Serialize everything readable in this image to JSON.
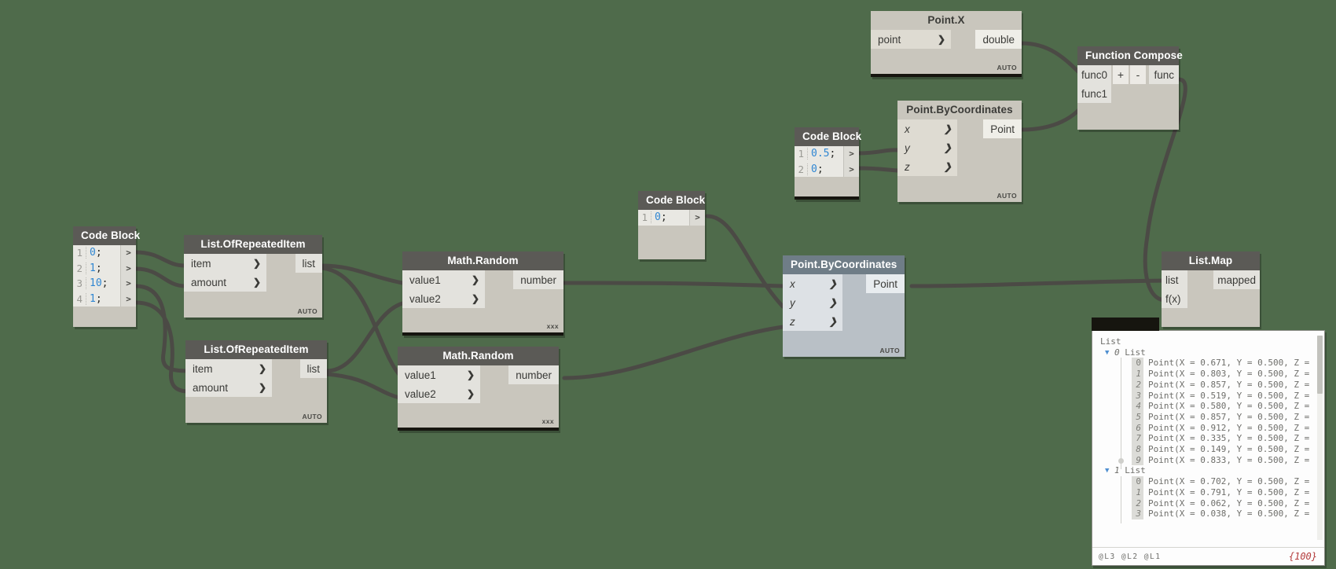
{
  "canvas": {
    "background": "#4f6b4b"
  },
  "nodes": {
    "code_block_1": {
      "title": "Code Block",
      "lines": [
        {
          "n": "1",
          "code": "0",
          "term": ";"
        },
        {
          "n": "2",
          "code": "1",
          "term": ";"
        },
        {
          "n": "3",
          "code": "10",
          "term": ";"
        },
        {
          "n": "4",
          "code": "1",
          "term": ";"
        }
      ],
      "out_marker": ">"
    },
    "list_of_repeated_item_1": {
      "title": "List.OfRepeatedItem",
      "inputs": [
        "item",
        "amount"
      ],
      "output": "list",
      "footer": "AUTO"
    },
    "list_of_repeated_item_2": {
      "title": "List.OfRepeatedItem",
      "inputs": [
        "item",
        "amount"
      ],
      "output": "list",
      "footer": "AUTO"
    },
    "math_random_1": {
      "title": "Math.Random",
      "inputs": [
        "value1",
        "value2"
      ],
      "output": "number",
      "footer": "xxx"
    },
    "math_random_2": {
      "title": "Math.Random",
      "inputs": [
        "value1",
        "value2"
      ],
      "output": "number",
      "footer": "xxx"
    },
    "code_block_2": {
      "title": "Code Block",
      "lines": [
        {
          "n": "1",
          "code": "0",
          "term": ";"
        }
      ],
      "out_marker": ">"
    },
    "code_block_3": {
      "title": "Code Block",
      "lines": [
        {
          "n": "1",
          "code": "0.5",
          "term": ";"
        },
        {
          "n": "2",
          "code": "0",
          "term": ";"
        }
      ],
      "out_marker": ">"
    },
    "point_bycoordinates_main": {
      "title": "Point.ByCoordinates",
      "inputs": [
        "x",
        "y",
        "z"
      ],
      "output": "Point",
      "footer": "AUTO"
    },
    "point_bycoordinates_top": {
      "title": "Point.ByCoordinates",
      "inputs": [
        "x",
        "y",
        "z"
      ],
      "output": "Point",
      "footer": "AUTO"
    },
    "point_x": {
      "title": "Point.X",
      "inputs": [
        "point"
      ],
      "output": "double",
      "footer": "AUTO"
    },
    "function_compose": {
      "title": "Function Compose",
      "inputs": [
        "func0",
        "func1"
      ],
      "output": "func",
      "buttons": [
        "+",
        "-"
      ]
    },
    "list_map": {
      "title": "List.Map",
      "inputs": [
        "list",
        "f(x)"
      ],
      "output": "mapped"
    }
  },
  "watch": {
    "root_label": "List",
    "groups": [
      {
        "index": "0",
        "label": "List",
        "items": [
          {
            "i": "0",
            "text": "Point(X = 0.671, Y = 0.500, Z ="
          },
          {
            "i": "1",
            "text": "Point(X = 0.803, Y = 0.500, Z ="
          },
          {
            "i": "2",
            "text": "Point(X = 0.857, Y = 0.500, Z ="
          },
          {
            "i": "3",
            "text": "Point(X = 0.519, Y = 0.500, Z ="
          },
          {
            "i": "4",
            "text": "Point(X = 0.580, Y = 0.500, Z ="
          },
          {
            "i": "5",
            "text": "Point(X = 0.857, Y = 0.500, Z ="
          },
          {
            "i": "6",
            "text": "Point(X = 0.912, Y = 0.500, Z ="
          },
          {
            "i": "7",
            "text": "Point(X = 0.335, Y = 0.500, Z ="
          },
          {
            "i": "8",
            "text": "Point(X = 0.149, Y = 0.500, Z ="
          },
          {
            "i": "9",
            "text": "Point(X = 0.833, Y = 0.500, Z ="
          }
        ]
      },
      {
        "index": "1",
        "label": "List",
        "items": [
          {
            "i": "0",
            "text": "Point(X = 0.702, Y = 0.500, Z ="
          },
          {
            "i": "1",
            "text": "Point(X = 0.791, Y = 0.500, Z ="
          },
          {
            "i": "2",
            "text": "Point(X = 0.062, Y = 0.500, Z ="
          },
          {
            "i": "3",
            "text": "Point(X = 0.038, Y = 0.500, Z ="
          }
        ]
      }
    ],
    "status_levels": "@L3 @L2 @L1",
    "status_count": "{100}"
  }
}
